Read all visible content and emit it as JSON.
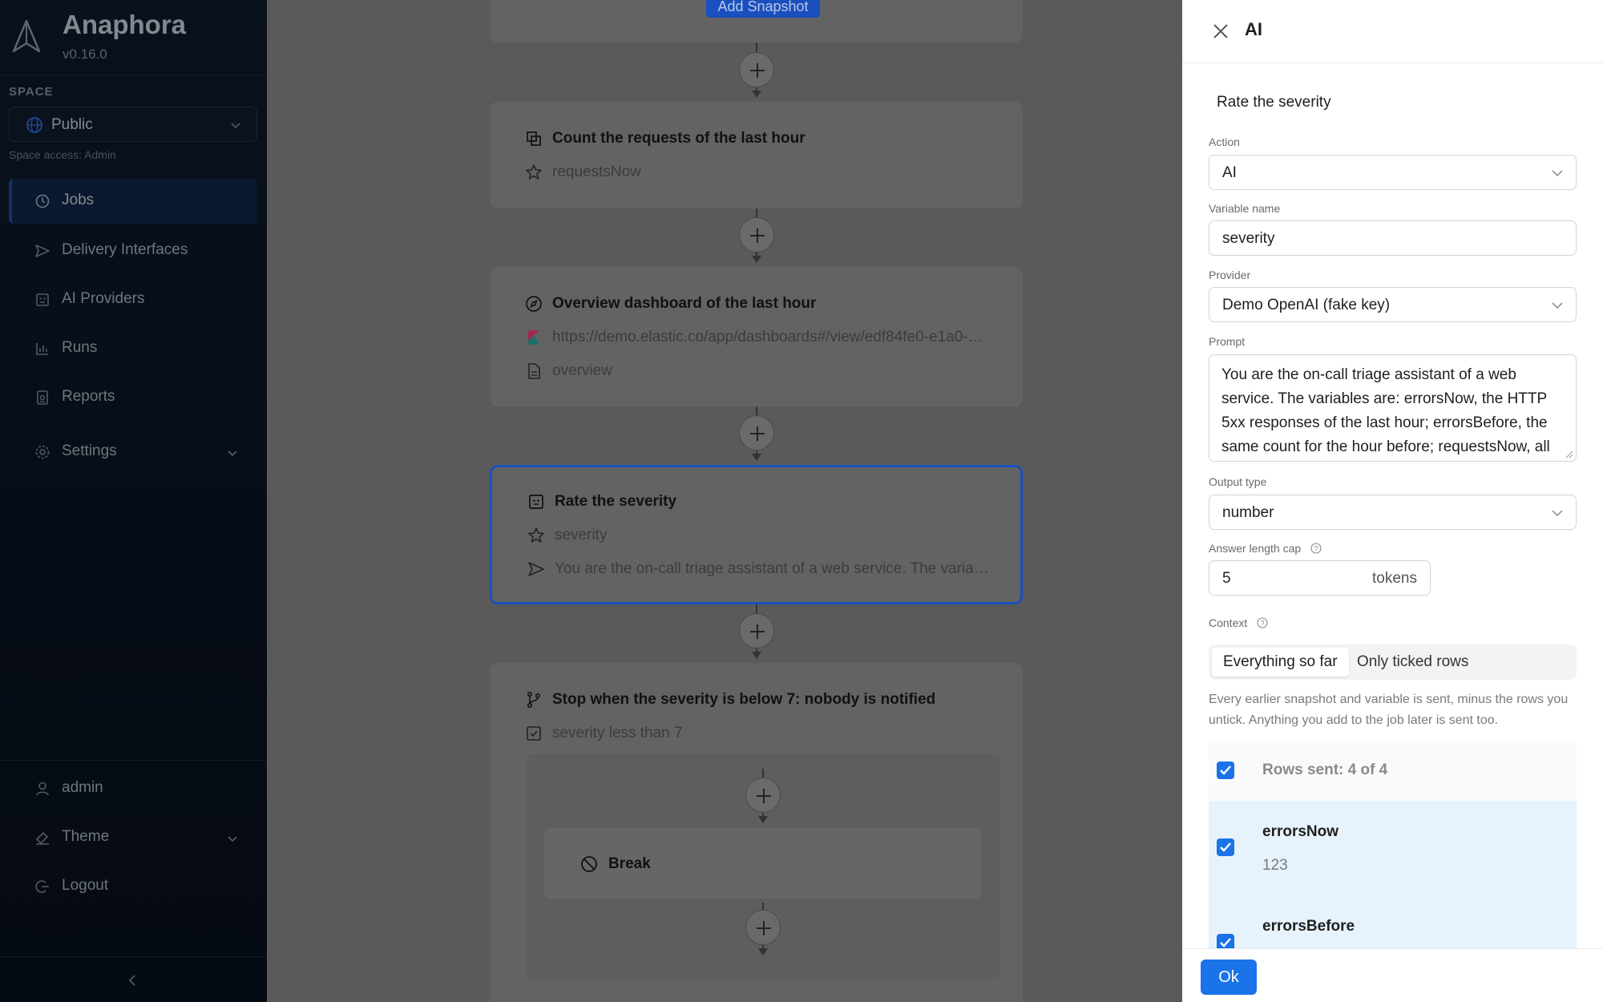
{
  "sidebar": {
    "app_title": "Anaphora",
    "version": "v0.16.0",
    "space_label": "SPACE",
    "space_value": "Public",
    "space_access": "Space access: Admin",
    "nav": [
      {
        "label": "Jobs",
        "icon": "history-icon",
        "active": true
      },
      {
        "label": "Delivery Interfaces",
        "icon": "send-icon"
      },
      {
        "label": "AI Providers",
        "icon": "robot-icon"
      },
      {
        "label": "Runs",
        "icon": "bar-chart-icon"
      },
      {
        "label": "Reports",
        "icon": "report-icon"
      },
      {
        "label": "Settings",
        "icon": "gear-icon"
      }
    ],
    "bottom": [
      {
        "label": "admin",
        "icon": "user-icon"
      },
      {
        "label": "Theme",
        "icon": "brush-icon"
      },
      {
        "label": "Logout",
        "icon": "logout-icon"
      }
    ]
  },
  "canvas": {
    "add_snapshot_label": "Add Snapshot",
    "cards": [
      {
        "title": "Count the requests of the last hour",
        "rows": [
          "requestsNow"
        ]
      },
      {
        "title": "Overview dashboard of the last hour",
        "rows": [
          "https://demo.elastic.co/app/dashboards#/view/edf84fe0-e1a0-…",
          "overview"
        ]
      },
      {
        "title": "Rate the severity",
        "rows": [
          "severity",
          "You are the on-call triage assistant of a web service. The varia…"
        ]
      },
      {
        "title": "Stop when the severity is below 7: nobody is notified",
        "rows": [
          "severity less than 7"
        ]
      }
    ],
    "break_label": "Break"
  },
  "drawer": {
    "title": "AI",
    "step_title": "Rate the severity",
    "action_label": "Action",
    "action_value": "AI",
    "variable_label": "Variable name",
    "variable_value": "severity",
    "provider_label": "Provider",
    "provider_value": "Demo OpenAI (fake key)",
    "prompt_label": "Prompt",
    "prompt_value": "You are the on-call triage assistant of a web service. The variables are: errorsNow, the HTTP 5xx responses of the last hour; errorsBefore, the same count for the hour before; requestsNow, all",
    "output_type_label": "Output type",
    "output_type_value": "number",
    "cap_label": "Answer length cap",
    "cap_value": "5",
    "cap_suffix": "tokens",
    "context_label": "Context",
    "context_options": [
      "Everything so far",
      "Only ticked rows"
    ],
    "context_desc": "Every earlier snapshot and variable is sent, minus the rows you untick. Anything you add to the job later is sent too.",
    "rows_header": "Rows sent: 4 of 4",
    "rows": [
      {
        "name": "errorsNow",
        "value": "123"
      },
      {
        "name": "errorsBefore",
        "value": ""
      }
    ],
    "ok_label": "Ok"
  },
  "colors": {
    "accent": "#1a73e8",
    "selected_border": "#1a4fbf",
    "sidebar_bg": "#0f1b2d",
    "rows_bg": "#e6f2fc"
  }
}
